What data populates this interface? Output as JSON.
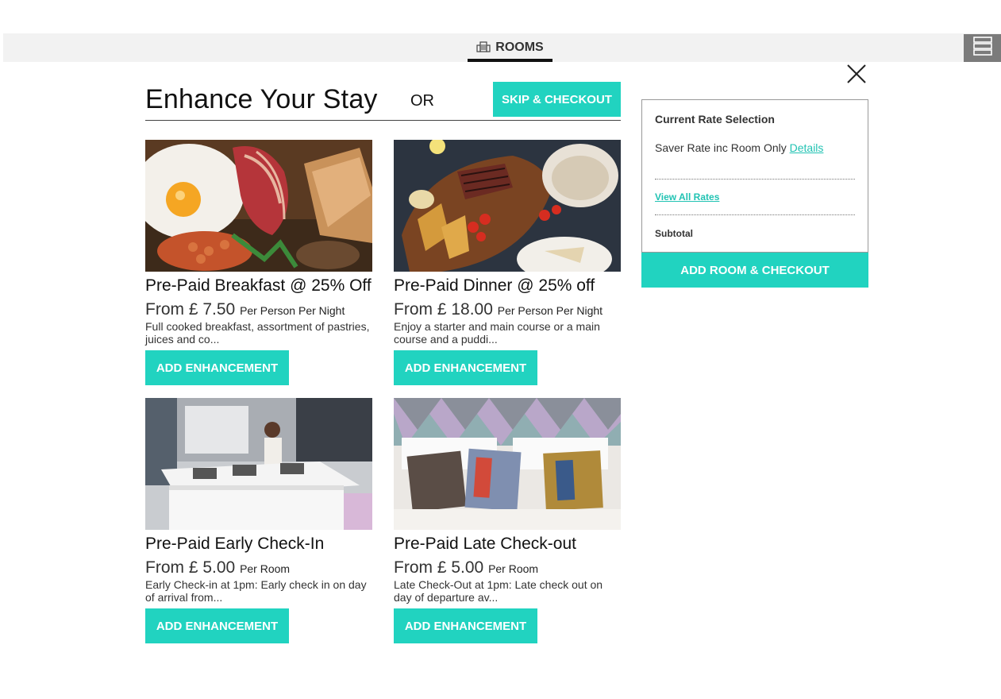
{
  "header": {
    "tab_label": "ROOMS",
    "tab_icon": "building-icon",
    "menu_icon": "hamburger-menu-icon"
  },
  "main": {
    "heading": "Enhance Your Stay",
    "or_text": "OR",
    "skip_label": "SKIP & CHECKOUT",
    "close_icon": "close-icon"
  },
  "enhancements": [
    {
      "title": "Pre-Paid Breakfast @ 25% Off",
      "price": "From £ 7.50",
      "unit": "Per Person Per Night",
      "description": "Full cooked breakfast, assortment of pastries, juices and co...",
      "button": "ADD ENHANCEMENT",
      "image": "breakfast-photo"
    },
    {
      "title": "Pre-Paid Dinner @ 25% off",
      "price": "From £ 18.00",
      "unit": "Per Person Per Night",
      "description": "Enjoy a starter and main course or a main course and a puddi...",
      "button": "ADD ENHANCEMENT",
      "image": "dinner-photo"
    },
    {
      "title": "Pre-Paid Early Check-In",
      "price": "From £ 5.00",
      "unit": "Per Room",
      "description": "Early Check-in at 1pm: Early check in on day of arrival from...",
      "button": "ADD ENHANCEMENT",
      "image": "reception-desk-photo"
    },
    {
      "title": "Pre-Paid Late Check-out",
      "price": "From £ 5.00",
      "unit": "Per Room",
      "description": "Late Check-Out at 1pm: Late check out on day of departure av...",
      "button": "ADD ENHANCEMENT",
      "image": "bed-cushions-photo"
    }
  ],
  "rate_panel": {
    "title": "Current Rate Selection",
    "rate_text": "Saver Rate inc Room Only",
    "details_link": "Details",
    "view_all_link": "View All Rates",
    "subtotal_label": "Subtotal",
    "checkout_button": "ADD ROOM & CHECKOUT"
  },
  "colors": {
    "accent": "#21d3c0",
    "topbar": "#f2f2f2",
    "menu_button": "#7b7b7b"
  }
}
